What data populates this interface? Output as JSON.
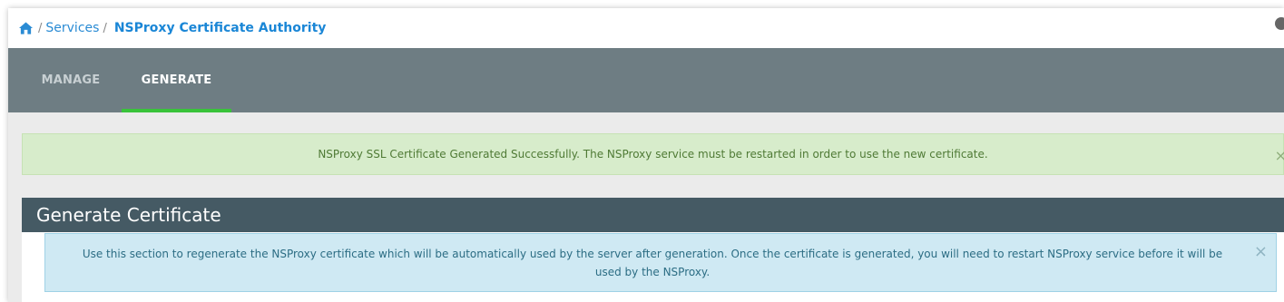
{
  "breadcrumb": {
    "home_icon": "home-icon",
    "separator": "/",
    "services": "Services",
    "current": "NSProxy Certificate Authority"
  },
  "tabs": [
    {
      "label": "MANAGE",
      "active": false
    },
    {
      "label": "GENERATE",
      "active": true
    }
  ],
  "colors": {
    "tab_active_underline": "#39c33a",
    "tab_bar": "#6e7d83",
    "panel_header": "#455a64",
    "success_bg": "#d7eccb",
    "info_bg": "#cfe9f3"
  },
  "success_alert": {
    "message": "NSProxy SSL Certificate Generated Successfully. The NSProxy service must be restarted in order to use the new certificate.",
    "close": "×"
  },
  "panel": {
    "title": "Generate Certificate",
    "info": {
      "message": "Use this section to regenerate the NSProxy certificate which will be automatically used by the server after generation. Once the certificate is generated, you will need to restart NSProxy service before it will be used by the NSProxy.",
      "close": "×"
    }
  }
}
